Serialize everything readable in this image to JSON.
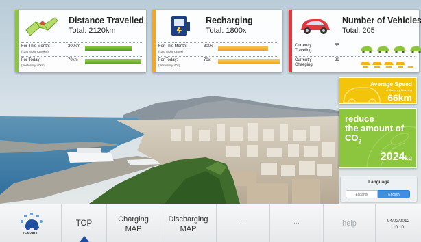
{
  "panels": {
    "distance": {
      "title": "Distance Travelled",
      "total": "Total: 2120km",
      "month_label": "For This Month:",
      "month_sub": "(Last Month:360km)",
      "month_value": "300km",
      "today_label": "For Today:",
      "today_sub": "(Yesterday:40km)",
      "today_value": "70km",
      "month_bar_level": 0.83,
      "today_bar_level": 1.0,
      "color": "#8cc63e"
    },
    "recharging": {
      "title": "Recharging",
      "total": "Total: 1800x",
      "month_label": "For This Month:",
      "month_sub": "(Last Month:350x)",
      "month_value": "300x",
      "today_label": "For Today:",
      "today_sub": "(Yesterday:40x)",
      "today_value": "70x",
      "month_bar_level": 0.82,
      "today_bar_level": 1.0,
      "color": "#f5a623"
    },
    "vehicles": {
      "title": "Number of Vehicles",
      "total": "Total: 205",
      "traveling_label": "Currently Traveling",
      "traveling_value": "55",
      "charging_label": "Currently Chaeging",
      "charging_value": "36",
      "color": "#e03a3e"
    }
  },
  "avg_speed": {
    "title": "Average Speed",
    "sub": "of Currency Traveling",
    "value": "66km",
    "color": "#f2c40a"
  },
  "co2": {
    "line1": "reduce",
    "line2": "the amount of",
    "line3": "CO",
    "line3_sub": "2",
    "value": "2024",
    "unit": "kg",
    "color": "#8cc63e"
  },
  "language": {
    "title": "Language",
    "options": [
      "Espanol",
      "English"
    ],
    "selected": "English"
  },
  "nav": {
    "logo_text": "ZEM2ALL",
    "top": "TOP",
    "charging_1": "Charging",
    "charging_2": "MAP",
    "discharging_1": "Discharging",
    "discharging_2": "MAP",
    "more1": "...",
    "more2": "...",
    "help": "help",
    "date": "04/02/2012",
    "time": "10:10",
    "active": "TOP"
  },
  "icons": {
    "distance": "map-icon",
    "recharging": "charger-icon",
    "vehicles": "car-icon",
    "logo": "sun-car-logo"
  }
}
